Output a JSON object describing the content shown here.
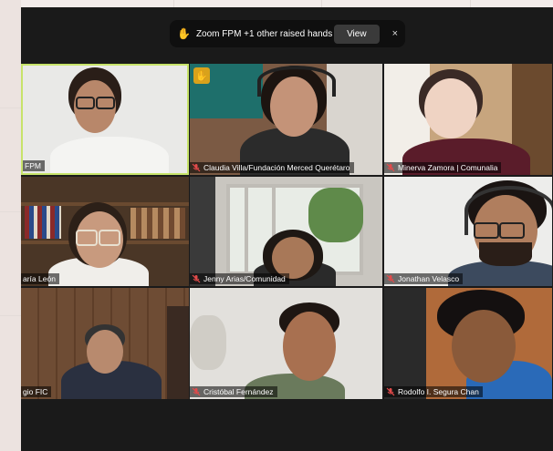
{
  "banner": {
    "message": "Zoom FPM  +1 other raised hands",
    "view_label": "View",
    "close_glyph": "×",
    "hand_glyph": "✋"
  },
  "tiles": [
    {
      "name": "FPM",
      "muted": false,
      "raised_hand": false,
      "active": true
    },
    {
      "name": "Claudia Villa/Fundación Merced Querétaro",
      "muted": true,
      "raised_hand": true,
      "active": false
    },
    {
      "name": "Minerva Zamora | Comunalia",
      "muted": true,
      "raised_hand": false,
      "active": false
    },
    {
      "name": "aría León",
      "muted": false,
      "raised_hand": false,
      "active": false
    },
    {
      "name": "Jenny Arias/Comunidad",
      "muted": true,
      "raised_hand": false,
      "active": false
    },
    {
      "name": "Jonathan Velasco",
      "muted": true,
      "raised_hand": false,
      "active": false
    },
    {
      "name": "gio FIC",
      "muted": false,
      "raised_hand": false,
      "active": false
    },
    {
      "name": "Cristóbal Fernández",
      "muted": true,
      "raised_hand": false,
      "active": false
    },
    {
      "name": "Rodolfo I. Segura Chan",
      "muted": true,
      "raised_hand": false,
      "active": false
    }
  ],
  "colors": {
    "active_border": "#c7e36a",
    "mic_off": "#e24b4b",
    "raised_hand": "#d9a21b"
  }
}
